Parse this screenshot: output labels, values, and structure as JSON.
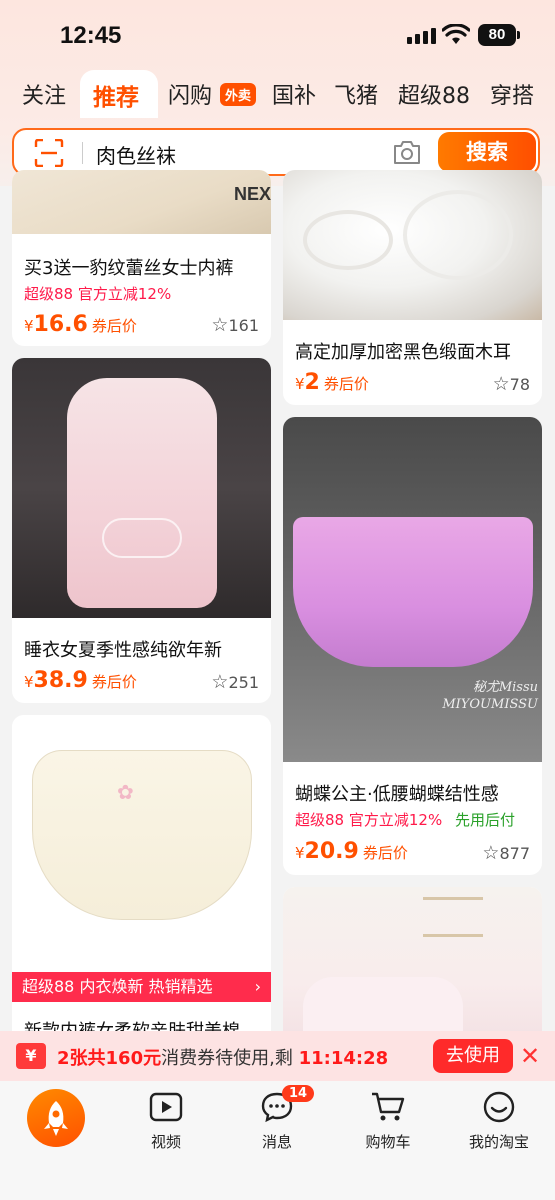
{
  "status_bar": {
    "time": "12:45",
    "battery": "80"
  },
  "tabs": [
    {
      "label": "关注"
    },
    {
      "label": "推荐"
    },
    {
      "label": "闪购"
    },
    {
      "label": "国补"
    },
    {
      "label": "飞猪"
    },
    {
      "label": "超级88"
    },
    {
      "label": "穿搭"
    }
  ],
  "tab_badge": "外卖",
  "search": {
    "query": "肉色丝袜",
    "button": "搜索"
  },
  "products": [
    {
      "title": "买3送一豹纹蕾丝女士内裤",
      "promo_tag": "超级88",
      "promo_desc": "官方立减12%",
      "yen": "¥",
      "price": "16.6",
      "price_suffix": "券后价",
      "favorites": "161"
    },
    {
      "title": "高定加厚加密黑色缎面木耳",
      "yen": "¥",
      "price": "2",
      "price_suffix": "券后价",
      "favorites": "78"
    },
    {
      "title": "睡衣女夏季性感纯欲年新",
      "yen": "¥",
      "price": "38.9",
      "price_suffix": "券后价",
      "favorites": "251"
    },
    {
      "title": "蝴蝶公主·低腰蝴蝶结性感",
      "promo_tag": "超级88",
      "promo_desc": "官方立减12%",
      "promo_extra": "先用后付",
      "yen": "¥",
      "price": "20.9",
      "price_suffix": "券后价",
      "favorites": "877",
      "watermark": "秘尤Missu MIYOUMISSU"
    },
    {
      "title": "新款内裤女柔软亲肤甜美棉",
      "banner": "超级88 内衣焕新 热销精选"
    }
  ],
  "coupon": {
    "icon": "¥",
    "count_text": "2张共160元",
    "text": "消费券待使用,剩",
    "countdown": "11:14:28",
    "button": "去使用"
  },
  "bottom_nav": [
    {
      "label": "视频"
    },
    {
      "label": "消息",
      "badge": "14"
    },
    {
      "label": "购物车"
    },
    {
      "label": "我的淘宝"
    }
  ],
  "colors": {
    "accent": "#ff5000",
    "promo": "#ff1a4a",
    "green": "#2aa12a"
  }
}
